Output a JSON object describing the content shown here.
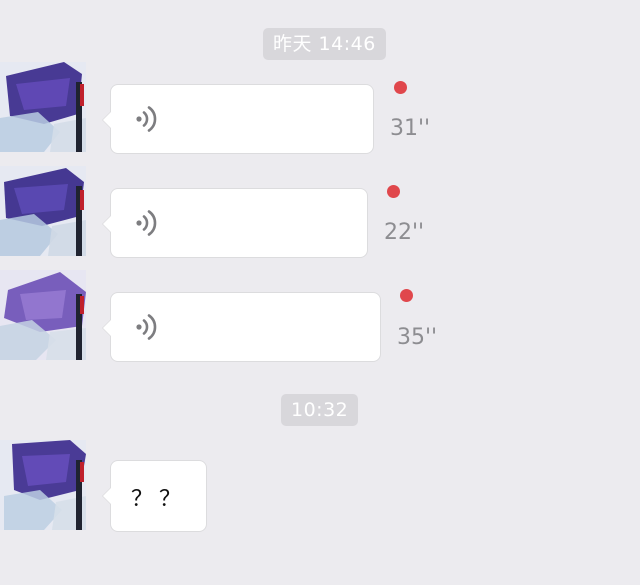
{
  "conversation": {
    "timestamps": [
      "昨天 14:46",
      "10:32"
    ],
    "voice_messages": [
      {
        "duration": "31''",
        "unread": true
      },
      {
        "duration": "22''",
        "unread": true
      },
      {
        "duration": "35''",
        "unread": true
      }
    ],
    "text_messages": [
      {
        "text": "？？"
      }
    ]
  },
  "colors": {
    "background": "#ecebef",
    "bubble": "#ffffff",
    "unread_dot": "#e0474c",
    "timestamp_pill": "#d8d7db",
    "duration_text": "#8d8d91"
  },
  "icons": {
    "voice": "voice-wave-icon",
    "avatar": "avatar"
  }
}
